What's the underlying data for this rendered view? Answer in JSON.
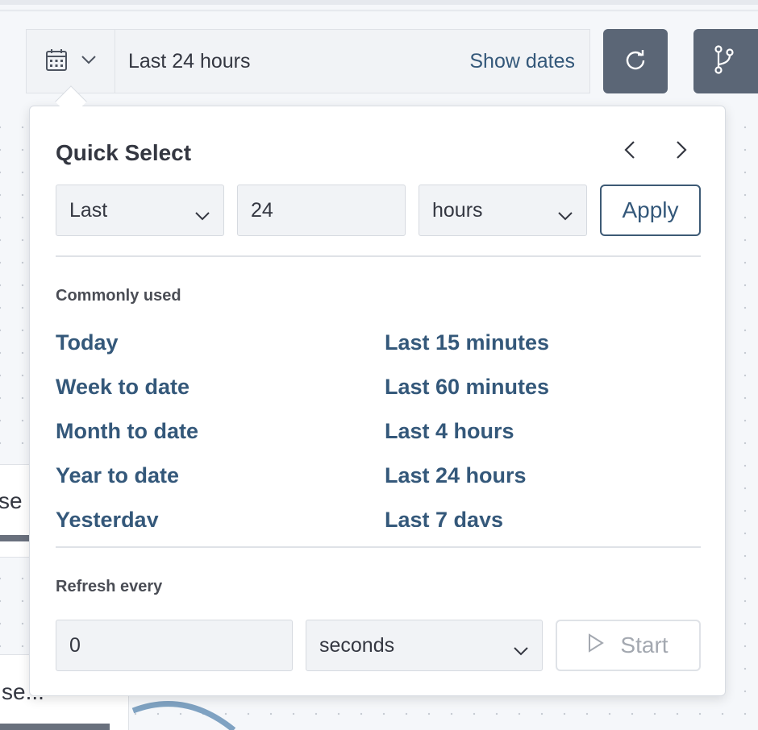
{
  "toolbar": {
    "range_text": "Last 24 hours",
    "show_dates_label": "Show dates",
    "calendar_icon": "calendar-icon",
    "refresh_icon": "refresh-icon",
    "branch_icon": "git-branch-icon"
  },
  "quick_select": {
    "title": "Quick Select",
    "direction_value": "Last",
    "amount_value": "24",
    "unit_value": "hours",
    "apply_label": "Apply",
    "prev_icon": "chevron-left-icon",
    "next_icon": "chevron-right-icon"
  },
  "commonly_used": {
    "label": "Commonly used",
    "items_left": [
      "Today",
      "Week to date",
      "Month to date",
      "Year to date",
      "Yesterday"
    ],
    "items_right": [
      "Last 15 minutes",
      "Last 60 minutes",
      "Last 4 hours",
      "Last 24 hours",
      "Last 7 days"
    ]
  },
  "refresh": {
    "label": "Refresh every",
    "interval_value": "0",
    "unit_value": "seconds",
    "start_label": "Start",
    "play_icon": "play-icon"
  },
  "background": {
    "fragment_1": "se",
    "fragment_2": "se..."
  },
  "colors": {
    "link": "#34587a",
    "icon_button": "#5b6676",
    "text": "#343741"
  }
}
